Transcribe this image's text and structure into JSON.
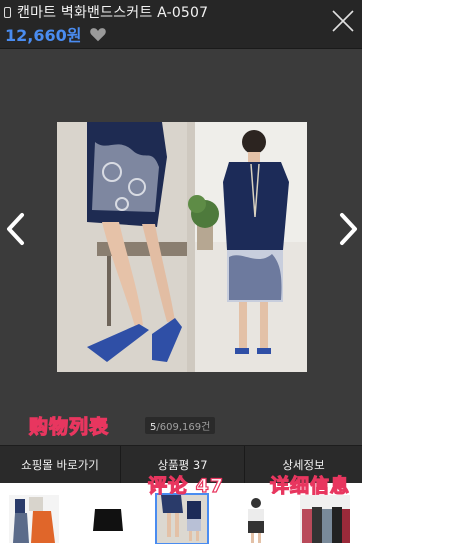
{
  "header": {
    "title": "캔마트 벽화밴드스커트 A-0507",
    "price": "12,660원"
  },
  "annotations": {
    "shopping_list": "购物列表",
    "reviews": "评论 47",
    "details": "详细信息"
  },
  "viewer": {
    "counter_current": "5",
    "counter_total": "/609,169건"
  },
  "tabs": [
    {
      "label": "쇼핑몰 바로가기"
    },
    {
      "label": "상품평 37"
    },
    {
      "label": "상세정보"
    }
  ],
  "thumbnails": {
    "count": 6,
    "selected_index": 2
  },
  "colors": {
    "price": "#4a8cf0",
    "annotation_outline": "#e8365f",
    "viewer_bg": "#3b3b3b",
    "topbar_bg": "#262626"
  }
}
